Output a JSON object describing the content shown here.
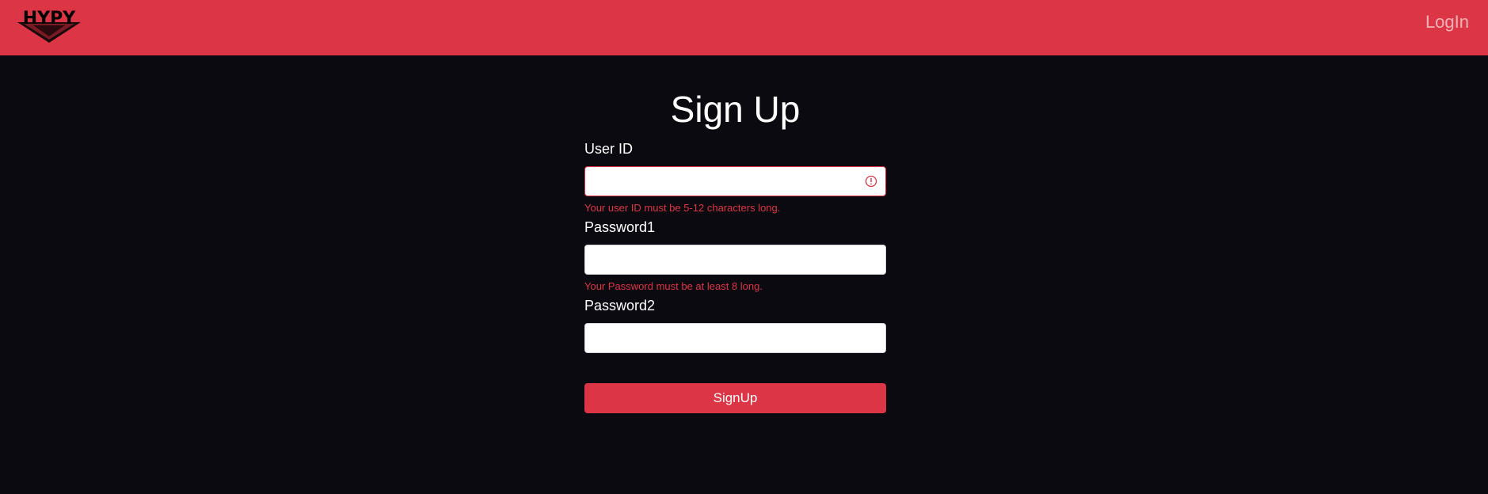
{
  "navbar": {
    "logo_text": "HYPY",
    "login_label": "LogIn"
  },
  "form": {
    "title": "Sign Up",
    "fields": [
      {
        "label": "User ID",
        "value": "",
        "error": "Your user ID must be 5-12 characters long."
      },
      {
        "label": "Password1",
        "value": "",
        "error": "Your Password must be at least 8 long."
      },
      {
        "label": "Password2",
        "value": "",
        "error": ""
      }
    ],
    "submit_label": "SignUp"
  },
  "colors": {
    "brand_red": "#dc3545",
    "background": "#0a0a10",
    "error_text": "#e03444"
  },
  "icons": {
    "field_error": "exclamation-circle-icon"
  }
}
